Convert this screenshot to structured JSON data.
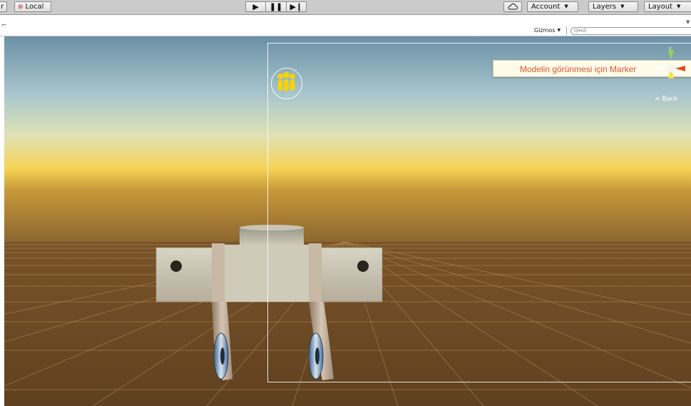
{
  "toolbar": {
    "pivot_fragment": "r",
    "local_label": "Local",
    "play_icon": "▶",
    "pause_icon": "❚❚",
    "step_icon": "▶❙",
    "cloud_icon": "cloud-icon",
    "account_label": "Account",
    "layers_label": "Layers",
    "layout_label": "Layout"
  },
  "scene": {
    "left_mark": "⌐",
    "gizmos_label": "Gizmos",
    "search_placeholder": "Q▾All"
  },
  "overlay": {
    "marker_text": "Modelin görünmesi için Marker",
    "back_label": "< Back"
  },
  "colors": {
    "marker_text": "#e3542c",
    "sky_top": "#6e93a8",
    "horizon": "#f3c84a",
    "ground": "#6d4a23",
    "gizmo_green": "#8bd84a",
    "gizmo_yellow": "#f4e53a",
    "gizmo_red": "#e44a2a",
    "icon_yellow": "#f4d20c"
  }
}
